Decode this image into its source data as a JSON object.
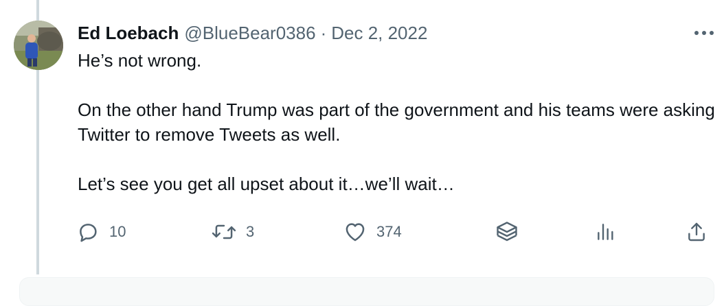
{
  "tweet": {
    "display_name": "Ed Loebach",
    "handle": "@BlueBear0386",
    "separator": "·",
    "date": "Dec 2, 2022",
    "paragraphs": [
      "He’s not wrong.",
      "On the other hand Trump was part of the government and his teams were asking Twitter to remove Tweets as well.",
      "Let’s see you get all upset about it…we’ll wait…"
    ]
  },
  "actions": {
    "reply": {
      "count": "10",
      "icon": "reply-bubble-icon"
    },
    "retweet": {
      "count": "3",
      "icon": "retweet-icon"
    },
    "like": {
      "count": "374",
      "icon": "heart-icon"
    },
    "views": {
      "icon": "stack-layers-icon"
    },
    "analytics": {
      "icon": "bar-chart-icon"
    },
    "share": {
      "icon": "share-upload-icon"
    }
  },
  "more": {
    "icon": "more-horizontal-icon"
  },
  "colors": {
    "text": "#0f1419",
    "secondary": "#536471",
    "thread_line": "#cfd9de"
  }
}
